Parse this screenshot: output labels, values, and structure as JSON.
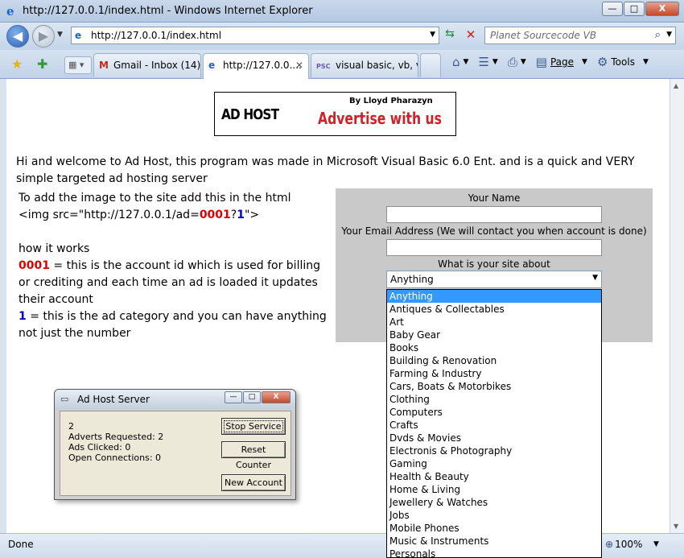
{
  "window": {
    "title": "http://127.0.0.1/index.html - Windows Internet Explorer",
    "controls": {
      "minimize": "—",
      "maximize": "□",
      "close": "X"
    }
  },
  "nav": {
    "address": "http://127.0.0.1/index.html",
    "search_placeholder": "Planet Sourcecode VB"
  },
  "tabs": [
    {
      "label": "Gmail - Inbox (14)",
      "icon": "M"
    },
    {
      "label": "http://127.0.0....",
      "icon": "e"
    },
    {
      "label": "visual basic, vb, v...",
      "icon": "PSC"
    }
  ],
  "toolbar": {
    "page": "Page",
    "tools": "Tools"
  },
  "banner": {
    "logo_text": "AD HOST",
    "byline": "By Lloyd Pharazyn",
    "tagline": "Advertise with us"
  },
  "content": {
    "intro": "Hi and welcome to Ad Host, this program was made in Microsoft Visual Basic 6.0 Ent. and is a quick and VERY simple targeted ad hosting server",
    "add_image_line": "To add the image to the site add this in the html",
    "code_prefix": "<img src=\"http://127.0.0.1/ad=",
    "code_account": "0001",
    "code_sep": "?",
    "code_category": "1",
    "code_suffix": "\">",
    "how_it_works": "how it works",
    "account_id": "0001",
    "account_desc": " = this is the account id which is used for billing or crediting and each time an ad is loaded it updates their account",
    "category_id": "1",
    "category_desc": " = this is the ad category and you can have anything not just the number"
  },
  "form": {
    "name_label": "Your Name",
    "email_label": "Your Email Address (We will contact you when account is done)",
    "site_label": "What is your site about",
    "selected_option": "Anything",
    "options": [
      "Anything",
      "Antiques & Collectables",
      "Art",
      "Baby Gear",
      "Books",
      "Building & Renovation",
      "Farming & Industry",
      "Cars, Boats & Motorbikes",
      "Clothing",
      "Computers",
      "Crafts",
      "Dvds & Movies",
      "Electronis & Photography",
      "Gaming",
      "Health & Beauty",
      "Home & Living",
      "Jewellery & Watches",
      "Jobs",
      "Mobile Phones",
      "Music & Instruments",
      "Personals"
    ]
  },
  "server_window": {
    "title": "Ad Host Server",
    "count": "2",
    "adverts_requested": "Adverts Requested: 2",
    "ads_clicked": "Ads Clicked: 0",
    "open_connections": "Open Connections: 0",
    "stop_service": "Stop Service",
    "reset_counter": "Reset Counter",
    "new_account": "New Account"
  },
  "status": {
    "text": "Done",
    "zoom": "100%"
  }
}
